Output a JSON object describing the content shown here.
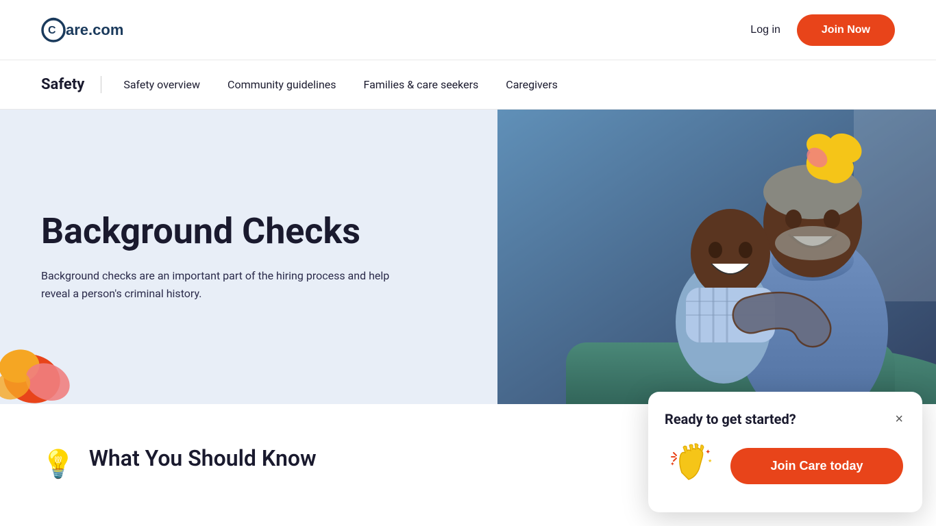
{
  "header": {
    "logo_text": "Care.com",
    "login_label": "Log in",
    "join_now_label": "Join Now"
  },
  "safety_nav": {
    "title": "Safety",
    "links": [
      {
        "label": "Safety overview",
        "id": "safety-overview"
      },
      {
        "label": "Community guidelines",
        "id": "community-guidelines"
      },
      {
        "label": "Families & care seekers",
        "id": "families-care-seekers"
      },
      {
        "label": "Caregivers",
        "id": "caregivers"
      }
    ]
  },
  "hero": {
    "title": "Background Checks",
    "description": "Background checks are an important part of the hiring process and help reveal a person's criminal history."
  },
  "lower": {
    "title": "What You Should Know",
    "bulb_icon": "💡"
  },
  "popup": {
    "title": "Ready to get started?",
    "join_label": "Join Care today",
    "close_label": "×"
  },
  "colors": {
    "accent_orange": "#e8441a",
    "navy": "#1a1a2e",
    "hero_bg": "#e8eef7"
  }
}
